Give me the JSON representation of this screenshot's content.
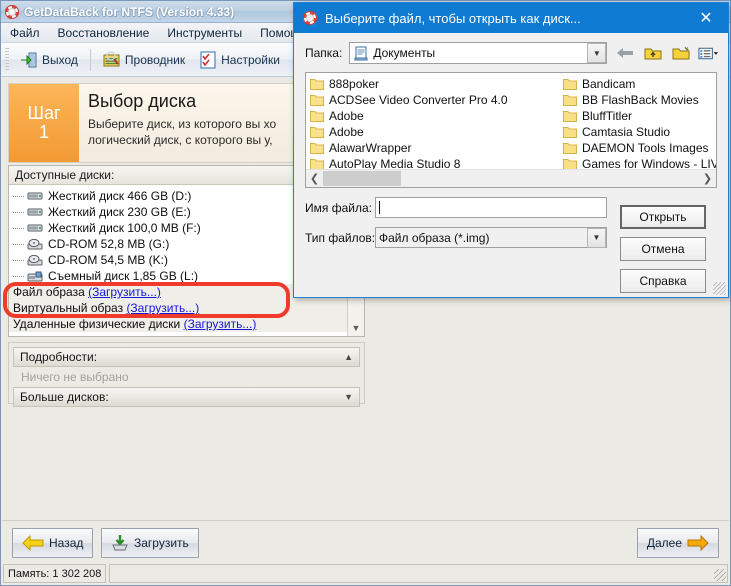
{
  "app": {
    "title": "GetDataBack for NTFS (Version 4.33)",
    "icon": "lifebuoy-icon",
    "menu": [
      "Файл",
      "Восстановление",
      "Инструменты",
      "Помощь"
    ],
    "toolbar": [
      {
        "label": "Выход",
        "icon": "exit-door-icon"
      },
      {
        "label": "Проводник",
        "icon": "explorer-icon"
      },
      {
        "label": "Настройки",
        "icon": "settings-checklist-icon"
      }
    ]
  },
  "step": {
    "word": "Шаг",
    "number": "1",
    "heading": "Выбор диска",
    "description": "Выберите диск, из которого вы хо\nлогический диск, с которого вы у,"
  },
  "disks": {
    "header": "Доступные диски:",
    "items": [
      {
        "label": "Жесткий диск 466 GB (D:)",
        "icon": "hard-disk-icon"
      },
      {
        "label": "Жесткий диск 230 GB (E:)",
        "icon": "hard-disk-icon"
      },
      {
        "label": "Жесткий диск 100,0 MB (F:)",
        "icon": "hard-disk-icon"
      },
      {
        "label": "CD-ROM 52,8 MB (G:)",
        "icon": "cdrom-icon"
      },
      {
        "label": "CD-ROM 54,5 MB (K:)",
        "icon": "cdrom-icon"
      },
      {
        "label": "Съемный диск 1,85 GB (L:)",
        "icon": "removable-disk-icon"
      }
    ],
    "image_rows": [
      {
        "label": "Файл образа",
        "link": "(Загрузить...)"
      },
      {
        "label": "Виртуальный образ",
        "link": "(Загрузить...)"
      },
      {
        "label": "Удаленные физические диски",
        "link": "(Загрузить...)"
      }
    ],
    "highlight_color": "#ef3b2c"
  },
  "details": {
    "title": "Подробности:",
    "empty_text": "Ничего не выбрано",
    "more_disks": "Больше дисков:"
  },
  "bottom": {
    "back": "Назад",
    "load": "Загрузить",
    "next": "Далее"
  },
  "status": {
    "memory": "Память: 1 302 208",
    "blank": ""
  },
  "dialog": {
    "title": "Выберите файл, чтобы открыть как диск...",
    "icon": "lifebuoy-icon",
    "close": "✕",
    "lookin_label": "Папка:",
    "lookin_value": "Документы",
    "nav_icons": [
      "back-arrow-icon",
      "up-folder-icon",
      "new-folder-icon",
      "view-list-icon"
    ],
    "files_col1": [
      "888poker",
      "ACDSee Video Converter Pro 4.0",
      "Adobe",
      "Adobe",
      "AlawarWrapper",
      "AutoPlay Media Studio 8"
    ],
    "files_col2": [
      "Bandicam",
      "BB FlashBack Movies",
      "BluffTitler",
      "Camtasia Studio",
      "DAEMON Tools Images",
      "Games for Windows - LIVE"
    ],
    "filename_label": "Имя файла:",
    "filename_value": "",
    "filetype_label": "Тип файлов:",
    "filetype_value": "Файл образа (*.img)",
    "buttons": {
      "open": "Открыть",
      "cancel": "Отмена",
      "help": "Справка"
    },
    "accent_color": "#0f7ad1"
  }
}
